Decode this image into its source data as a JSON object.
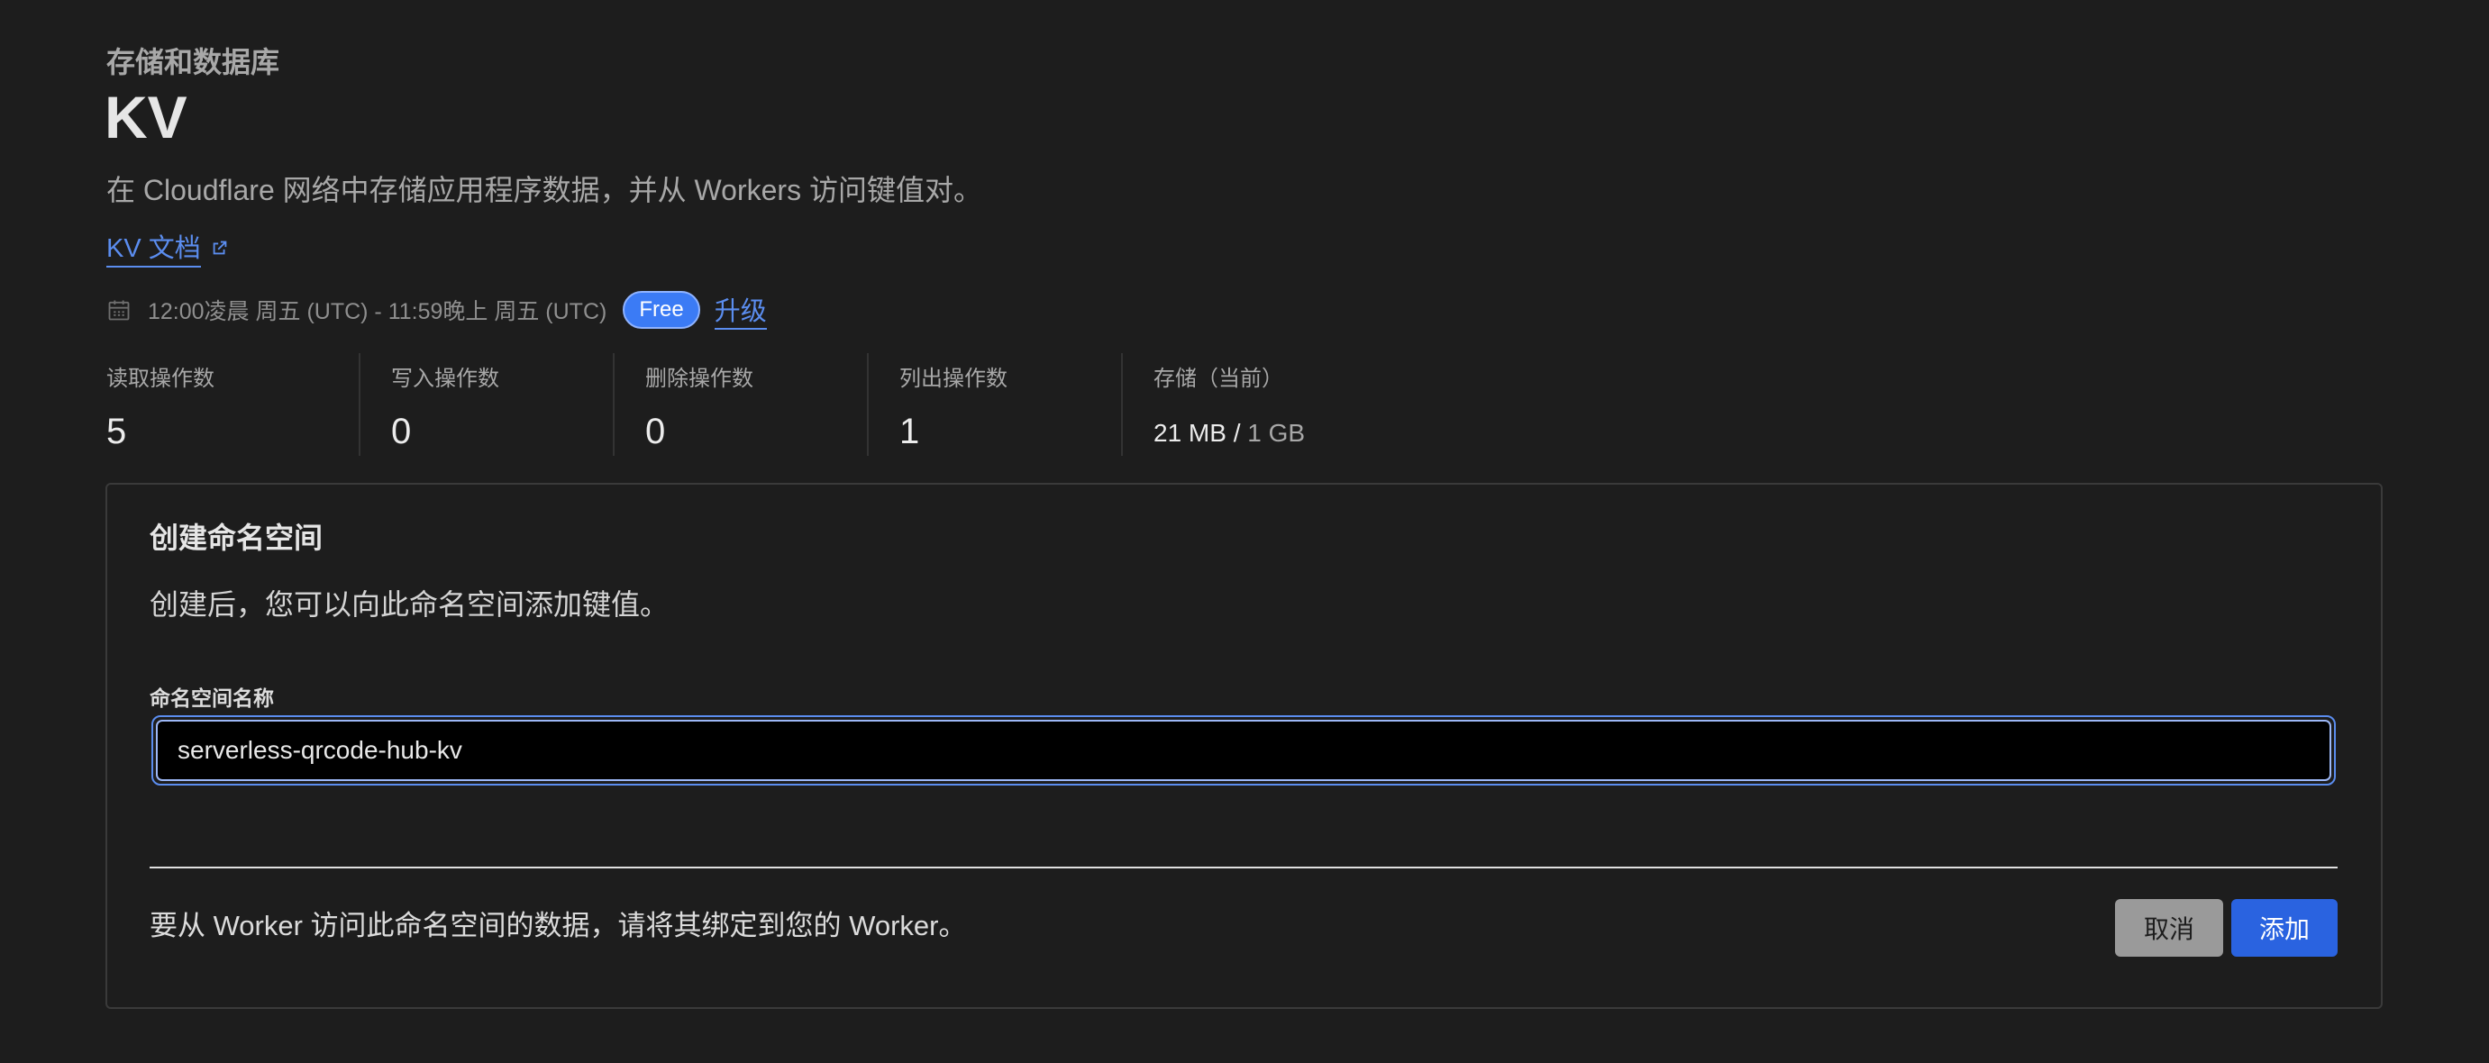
{
  "header": {
    "breadcrumb": "存储和数据库",
    "title": "KV",
    "description": "在 Cloudflare 网络中存储应用程序数据，并从 Workers 访问键值对。",
    "doc_link": "KV 文档"
  },
  "usage": {
    "period": "12:00凌晨 周五 (UTC) - 11:59晚上 周五 (UTC)",
    "plan_badge": "Free",
    "upgrade_label": "升级",
    "stats": [
      {
        "label": "读取操作数",
        "value": "5"
      },
      {
        "label": "写入操作数",
        "value": "0"
      },
      {
        "label": "删除操作数",
        "value": "0"
      },
      {
        "label": "列出操作数",
        "value": "1"
      }
    ],
    "storage": {
      "label": "存储（当前）",
      "used": "21 MB",
      "separator": " / ",
      "total": "1 GB"
    }
  },
  "create_namespace": {
    "title": "创建命名空间",
    "subtitle": "创建后，您可以向此命名空间添加键值。",
    "field_label": "命名空间名称",
    "field_value": "serverless-qrcode-hub-kv",
    "footer_note": "要从 Worker 访问此命名空间的数据，请将其绑定到您的 Worker。",
    "cancel_label": "取消",
    "add_label": "添加"
  },
  "colors": {
    "background": "#1d1d1d",
    "accent": "#5b8def",
    "primary_button": "#2a63e0"
  },
  "icons": {
    "doc_link": "external-link-icon",
    "period": "calendar-icon"
  }
}
